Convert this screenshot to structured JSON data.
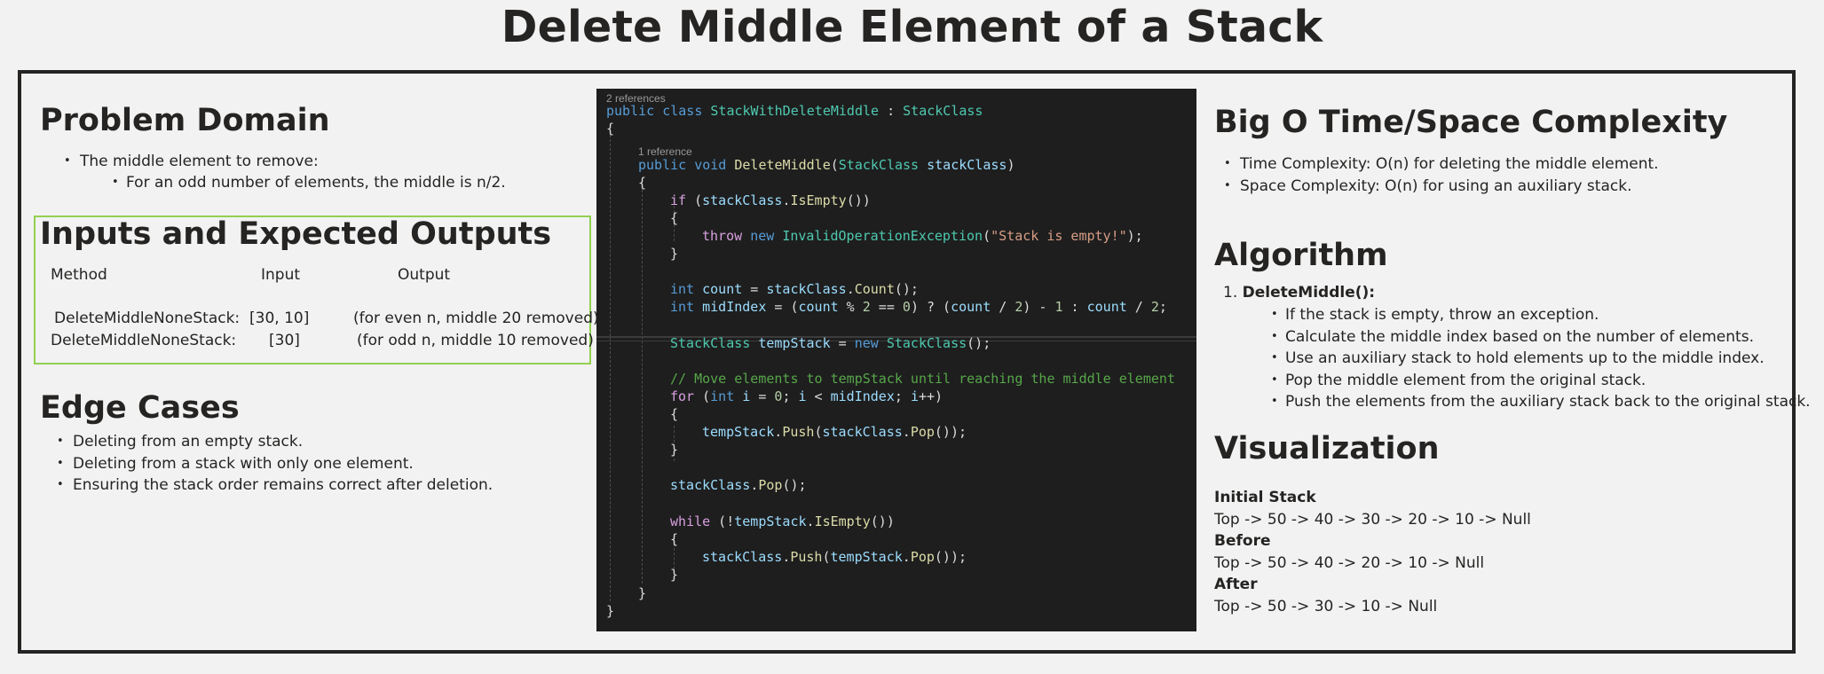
{
  "title": "Delete Middle Element of a Stack",
  "problem_domain": {
    "heading": "Problem Domain",
    "bullet": "The middle element to remove:",
    "sub_bullet": "For an odd number of elements, the middle is n/2."
  },
  "inputs_outputs": {
    "heading": "Inputs and Expected Outputs",
    "columns": [
      "Method",
      "Input",
      "Output"
    ],
    "rows": [
      {
        "method": "DeleteMiddleNoneStack:",
        "input": "[30, 10]",
        "output": "(for even n, middle 20 removed)"
      },
      {
        "method": "DeleteMiddleNoneStack:",
        "input": "[30]",
        "output": "(for odd n, middle 10 removed)"
      }
    ]
  },
  "edge_cases": {
    "heading": "Edge Cases",
    "items": [
      "Deleting from an empty stack.",
      "Deleting from a stack with only one element.",
      "Ensuring the stack order remains correct after deletion."
    ]
  },
  "code": {
    "refs_class": "2 references",
    "refs_method": "1 reference",
    "lines": [
      "public class StackWithDeleteMiddle : StackClass",
      "{",
      "public void DeleteMiddle(StackClass stackClass)",
      "{",
      "if (stackClass.IsEmpty())",
      "{",
      "throw new InvalidOperationException(\"Stack is empty!\");",
      "}",
      "int count = stackClass.Count();",
      "int midIndex = (count % 2 == 0) ? (count / 2) - 1 : count / 2;",
      "StackClass tempStack = new StackClass();",
      "// Move elements to tempStack until reaching the middle element",
      "for (int i = 0; i < midIndex; i++)",
      "{",
      "tempStack.Push(stackClass.Pop());",
      "}",
      "stackClass.Pop();",
      "while (!tempStack.IsEmpty())",
      "{",
      "stackClass.Push(tempStack.Pop());",
      "}",
      "}",
      "}"
    ]
  },
  "complexity": {
    "heading": "Big O Time/Space Complexity",
    "items": [
      "Time Complexity: O(n) for deleting the middle element.",
      "Space Complexity: O(n) for using an auxiliary stack."
    ]
  },
  "algorithm": {
    "heading": "Algorithm",
    "number": "1.",
    "step": "DeleteMiddle():",
    "sub_items": [
      "If the stack is empty, throw an exception.",
      "Calculate the middle index based on the number of elements.",
      "Use an auxiliary stack to hold elements up to the middle index.",
      "Pop the middle element from the original stack.",
      "Push the elements from the auxiliary stack back to the original stack."
    ]
  },
  "visualization": {
    "heading": "Visualization",
    "initial_label": "Initial Stack",
    "initial": "Top -> 50 -> 40 -> 30 -> 20 -> 10 -> Null",
    "before_label": "Before",
    "before": "Top -> 50 -> 40 -> 20 -> 10 -> Null",
    "after_label": "After",
    "after": "Top -> 50 -> 30 -> 10 -> Null"
  },
  "colors": {
    "background": "#f2f2f2",
    "text": "#252423",
    "frame_border": "#252423",
    "io_box_border": "#92d050",
    "code_background": "#1e1e1e"
  }
}
